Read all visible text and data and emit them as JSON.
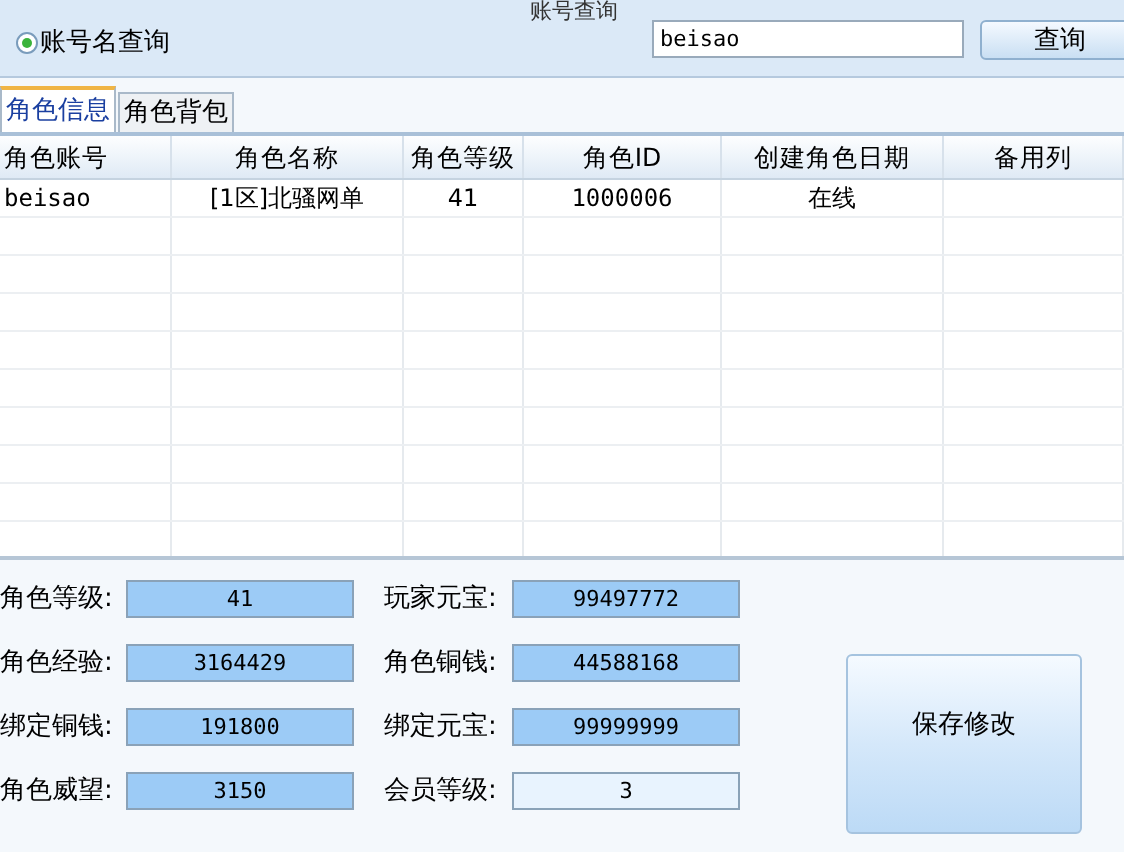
{
  "search_group": {
    "title": "账号查询",
    "radio": {
      "label": "账号名查询",
      "checked": true
    },
    "input": {
      "value": "beisao"
    },
    "button": "查询"
  },
  "tabs": [
    {
      "label": "角色信息",
      "selected": true
    },
    {
      "label": "角色背包",
      "selected": false
    }
  ],
  "table": {
    "columns": [
      "角色账号",
      "角色名称",
      "角色等级",
      "角色ID",
      "创建角色日期",
      "备用列"
    ],
    "rows": [
      [
        "beisao",
        "[1区]北骚网单",
        "41",
        "1000006",
        "在线",
        ""
      ]
    ]
  },
  "fields": [
    {
      "label": "角色等级:",
      "value": "41",
      "highlight": true
    },
    {
      "label": "玩家元宝:",
      "value": "99497772",
      "highlight": true
    },
    {
      "label": "角色经验:",
      "value": "3164429",
      "highlight": true
    },
    {
      "label": "角色铜钱:",
      "value": "44588168",
      "highlight": true
    },
    {
      "label": "绑定铜钱:",
      "value": "191800",
      "highlight": true
    },
    {
      "label": "绑定元宝:",
      "value": "99999999",
      "highlight": true
    },
    {
      "label": "角色威望:",
      "value": "3150",
      "highlight": true
    },
    {
      "label": "会员等级:",
      "value": "3",
      "highlight": false
    }
  ],
  "save_button": "保存修改"
}
